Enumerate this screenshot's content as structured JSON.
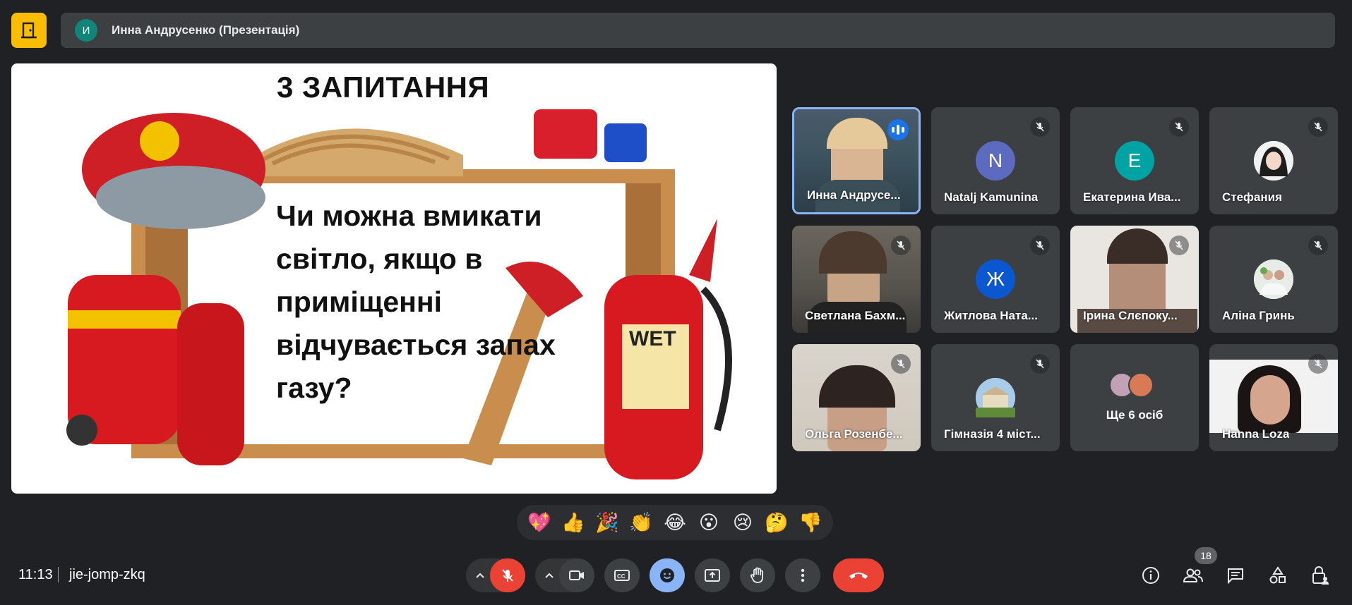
{
  "header": {
    "presenter_initial": "И",
    "presenter_title": "Инна Андрусенко (Презентація)"
  },
  "slide": {
    "heading": "3 ЗАПИТАННЯ",
    "question": "Чи можна вмикати світло, якщо в приміщенні відчувається запах газу?",
    "sign_text": "WET"
  },
  "participants": [
    {
      "name": "Инна Андрусе...",
      "type": "video",
      "speaking": true,
      "muted": false
    },
    {
      "name": "Natalj Kamunina",
      "type": "avatar",
      "initial": "N",
      "color": "#5c6bc0",
      "muted": true
    },
    {
      "name": "Екатерина Ива...",
      "type": "avatar",
      "initial": "Е",
      "color": "#00a3a3",
      "muted": true
    },
    {
      "name": "Стефания",
      "type": "photo",
      "muted": true
    },
    {
      "name": "Светлана Бахм...",
      "type": "video",
      "muted": true
    },
    {
      "name": "Житлова Ната...",
      "type": "avatar",
      "initial": "Ж",
      "color": "#0b57d0",
      "muted": true
    },
    {
      "name": "Ірина Слєпоку...",
      "type": "video",
      "muted": true
    },
    {
      "name": "Аліна Гринь",
      "type": "photo",
      "muted": true
    },
    {
      "name": "Ольга Розенбе...",
      "type": "video",
      "muted": true
    },
    {
      "name": "Гімназія 4 міст...",
      "type": "photo",
      "muted": true
    },
    {
      "name": "Ще 6 осіб",
      "type": "more"
    },
    {
      "name": "Hanna Loza",
      "type": "video",
      "muted": true
    }
  ],
  "reactions": [
    "💖",
    "👍",
    "🎉",
    "👏",
    "😂",
    "😮",
    "😢",
    "🤔",
    "👎"
  ],
  "footer": {
    "time": "11:13",
    "meeting_code": "jie-jomp-zkq",
    "people_count": "18"
  },
  "colors": {
    "background": "#202124",
    "tile": "#3c4043",
    "end_call": "#ea4335",
    "mic_off": "#ea4335",
    "active_border": "#8ab4f8",
    "logo": "#fbbc04"
  }
}
